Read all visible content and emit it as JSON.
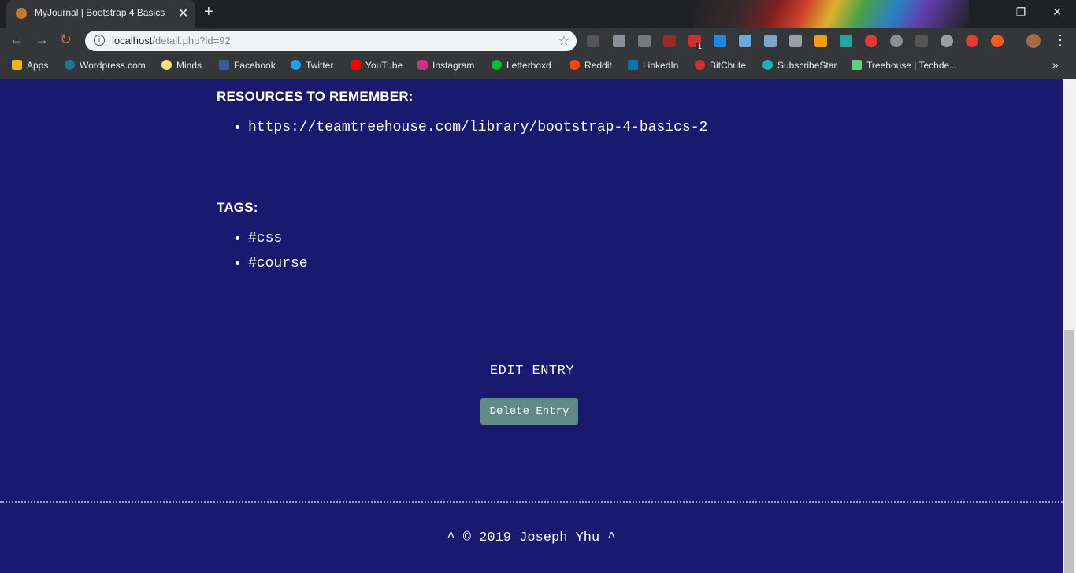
{
  "browser": {
    "tab_title": "MyJournal | Bootstrap 4 Basics",
    "tab_close": "✕",
    "new_tab": "+",
    "url_host": "localhost",
    "url_path": "/detail.php?id=92",
    "win_minimize": "—",
    "win_restore": "❐",
    "win_close": "✕",
    "menu": "⋮",
    "more_bookmarks": "»",
    "extension_badge": "1"
  },
  "bookmarks": [
    {
      "label": "Apps",
      "icon": "apps-grid-icon",
      "color": "#f4b400"
    },
    {
      "label": "Wordpress.com",
      "icon": "wordpress-icon",
      "color": "#21759b"
    },
    {
      "label": "Minds",
      "icon": "lightbulb-icon",
      "color": "#f3e37a"
    },
    {
      "label": "Facebook",
      "icon": "facebook-icon",
      "color": "#3b5998"
    },
    {
      "label": "Twitter",
      "icon": "twitter-icon",
      "color": "#1da1f2"
    },
    {
      "label": "YouTube",
      "icon": "youtube-icon",
      "color": "#ff0000"
    },
    {
      "label": "Instagram",
      "icon": "instagram-icon",
      "color": "#c13584"
    },
    {
      "label": "Letterboxd",
      "icon": "letterboxd-icon",
      "color": "#00c030"
    },
    {
      "label": "Reddit",
      "icon": "reddit-icon",
      "color": "#ff4500"
    },
    {
      "label": "LinkedIn",
      "icon": "linkedin-icon",
      "color": "#0077b5"
    },
    {
      "label": "BitChute",
      "icon": "bitchute-icon",
      "color": "#d32f2f"
    },
    {
      "label": "SubscribeStar",
      "icon": "subscribestar-icon",
      "color": "#1fb1b8"
    },
    {
      "label": "Treehouse | Techde...",
      "icon": "treehouse-icon",
      "color": "#5fcf80"
    }
  ],
  "entry": {
    "resources_heading": "RESOURCES TO REMEMBER:",
    "resources": [
      "https://teamtreehouse.com/library/bootstrap-4-basics-2"
    ],
    "tags_heading": "TAGS:",
    "tags": [
      "#css",
      "#course"
    ],
    "edit_label": "EDIT ENTRY",
    "delete_label": "Delete Entry"
  },
  "footer": {
    "text": "^ © 2019 Joseph Yhu ^"
  },
  "colors": {
    "page_background": "#191970",
    "delete_button": "#5f8a85",
    "text": "#ffffff"
  }
}
